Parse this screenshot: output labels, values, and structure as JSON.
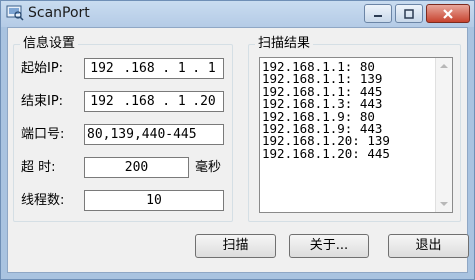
{
  "window": {
    "title": "ScanPort"
  },
  "info_group": {
    "title": "信息设置",
    "start_ip": {
      "label": "起始IP:",
      "segments": [
        "192",
        ".168",
        ". 1",
        ". 1"
      ]
    },
    "end_ip": {
      "label": "结束IP:",
      "segments": [
        "192",
        ".168",
        ". 1",
        ".20"
      ]
    },
    "port": {
      "label": "端口号:",
      "value": "80,139,440-445"
    },
    "timeout": {
      "label": "超  时:",
      "value": "200",
      "unit": "毫秒"
    },
    "threads": {
      "label": "线程数:",
      "value": "10"
    }
  },
  "result_group": {
    "title": "扫描结果",
    "items": [
      "192.168.1.1: 80",
      "192.168.1.1: 139",
      "192.168.1.1: 445",
      "192.168.1.3: 443",
      "192.168.1.9: 80",
      "192.168.1.9: 443",
      "192.168.1.20: 139",
      "192.168.1.20: 445"
    ]
  },
  "buttons": {
    "scan": "扫描",
    "about": "关于...",
    "exit": "退出"
  },
  "colors": {
    "titlebar": "#b4cbe6",
    "client_bg": "#f0f0f0",
    "close_button": "#c7432f"
  }
}
